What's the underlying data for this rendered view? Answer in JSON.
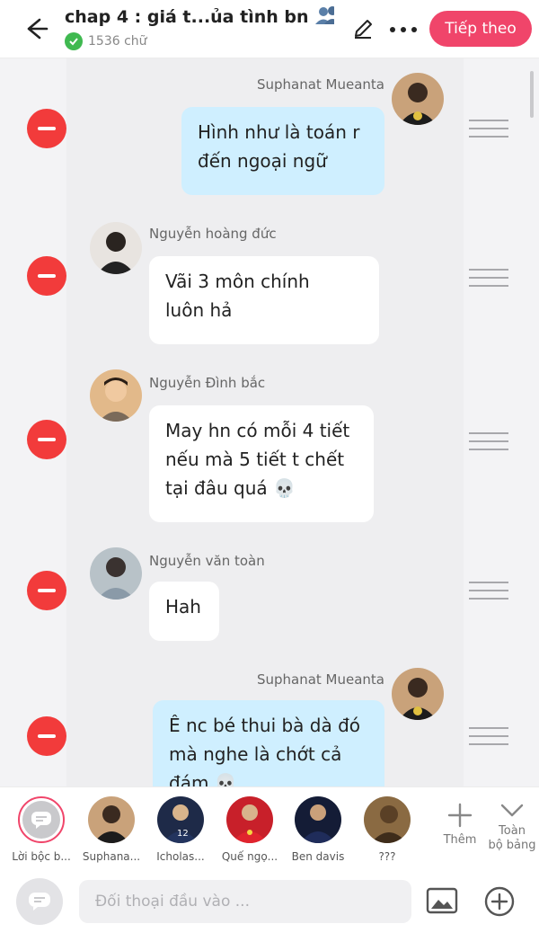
{
  "header": {
    "title": "chap 4 : giá t...ủa tình bn",
    "word_count": "1536 chữ",
    "next_label": "Tiếp theo"
  },
  "messages": [
    {
      "sender": "Suphanat Mueanta",
      "side": "right",
      "lines": [
        "Hình như là toán r",
        "đến ngoại ngữ"
      ]
    },
    {
      "sender": "Nguyễn hoàng đức",
      "side": "left",
      "lines": [
        "Vãi 3 môn chính",
        "luôn hả"
      ]
    },
    {
      "sender": "Nguyễn Đình bắc",
      "side": "left",
      "lines": [
        "May hn có mỗi 4 tiết",
        "nếu mà 5 tiết t chết",
        "tại đâu quá 💀"
      ]
    },
    {
      "sender": "Nguyễn văn toàn",
      "side": "left",
      "lines": [
        "Hah"
      ]
    },
    {
      "sender": "Suphanat Mueanta",
      "side": "right",
      "lines": [
        "Ê nc bé thui bà dà đó",
        "mà nghe là chớt cả",
        "đám 💀"
      ]
    }
  ],
  "characters": [
    {
      "label": "Lời bộc b..."
    },
    {
      "label": "Suphana..."
    },
    {
      "label": "Icholas..."
    },
    {
      "label": "Quế ngọ..."
    },
    {
      "label": "Ben davis"
    },
    {
      "label": "???"
    }
  ],
  "tools": {
    "add_label": "Thêm",
    "board_label_1": "Toàn",
    "board_label_2": "bộ bảng"
  },
  "input": {
    "placeholder": "Đối thoại đầu vào ..."
  },
  "colors": {
    "accent": "#f0456a",
    "delete": "#f23b3b",
    "my_bubble": "#cfefff",
    "other_bubble": "#ffffff",
    "verified": "#3fb950"
  },
  "icons": [
    "back-arrow-icon",
    "verified-check-icon",
    "edit-pen-icon",
    "more-dots-icon",
    "delete-minus-icon",
    "drag-handle-icon",
    "narration-icon",
    "plus-icon",
    "chevron-down-icon",
    "image-icon",
    "add-circle-icon"
  ]
}
